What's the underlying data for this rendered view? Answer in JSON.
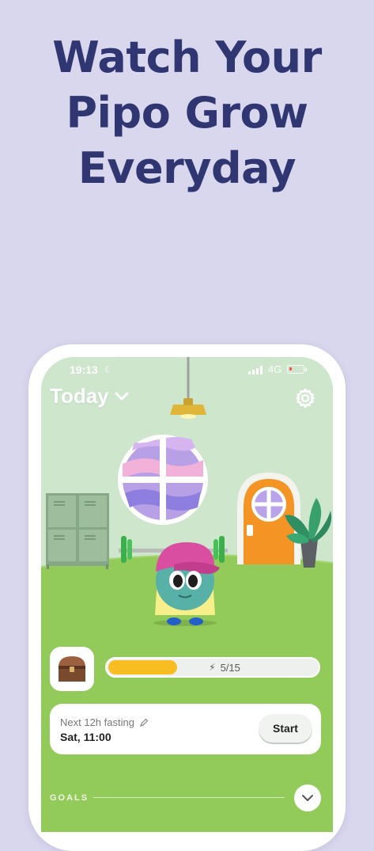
{
  "headline": {
    "line1": "Watch Your",
    "line2": "Pipo Grow",
    "line3": "Everyday"
  },
  "status_bar": {
    "time": "19:13",
    "network": "4G"
  },
  "header": {
    "title": "Today"
  },
  "progress": {
    "label": "5/15",
    "current": 5,
    "total": 15,
    "fill_fraction": 0.333
  },
  "fasting": {
    "title": "Next 12h fasting",
    "time": "Sat, 11:00",
    "start_label": "Start"
  },
  "goals": {
    "label": "GOALS"
  },
  "colors": {
    "background": "#d9d7ee",
    "headline": "#2f3672",
    "room_wall": "#cde6cc",
    "floor": "#93cb5a",
    "progress_fill": "#f8bd21",
    "door": "#f39425"
  },
  "icons": {
    "moon": "moon-icon",
    "settings": "gear-icon",
    "dropdown": "chevron-down-icon",
    "bolt": "lightning-icon",
    "edit": "pencil-icon",
    "goals_toggle": "chevron-down-icon",
    "chest": "treasure-chest-icon"
  }
}
